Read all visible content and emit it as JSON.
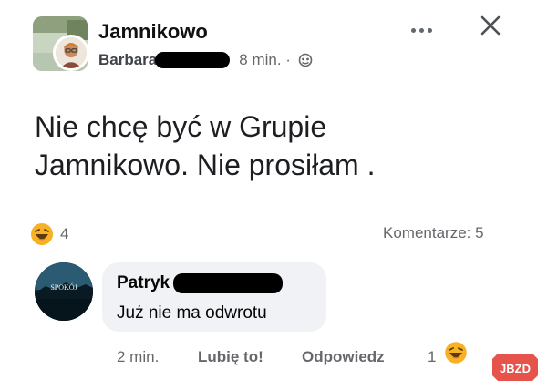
{
  "post": {
    "group_name": "Jamnikowo",
    "author": "Barbara",
    "time": "8 min. ·",
    "text_line1": "Nie chcę być w Grupie",
    "text_line2": "Jamnikowo. Nie prosiłam ."
  },
  "reactions": {
    "emoji": "haha-icon",
    "count": "4"
  },
  "comments_summary": "Komentarze: 5",
  "comment": {
    "author": "Patryk",
    "avatar_text": "SPOKÓJ",
    "text": "Już nie ma odwrotu",
    "time": "2 min.",
    "like_label": "Lubię to!",
    "reply_label": "Odpowiedz",
    "reaction_count": "1",
    "reaction_emoji": "haha-icon"
  },
  "watermark": "JBZD",
  "colors": {
    "text": "#050505",
    "secondary": "#65676b",
    "bubble": "#f0f2f5",
    "emoji": "#f7b125",
    "watermark": "#e5534b"
  }
}
